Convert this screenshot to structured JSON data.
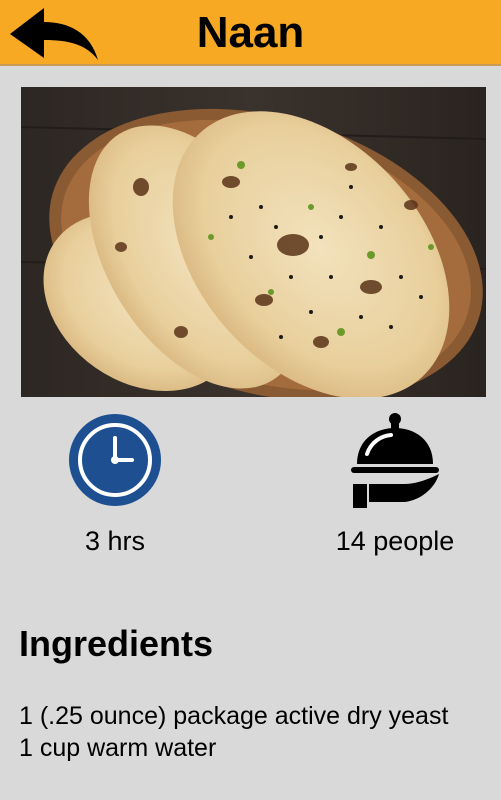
{
  "header": {
    "title": "Naan",
    "back_icon": "back-arrow-icon",
    "background_color": "#f7a924"
  },
  "hero_image": {
    "subject": "naan bread in basket"
  },
  "stats": {
    "time": {
      "icon": "clock-icon",
      "label": "3 hrs",
      "icon_color": "#1d4f91"
    },
    "serves": {
      "icon": "serving-cloche-icon",
      "label": "14 people"
    }
  },
  "ingredients": {
    "heading": "Ingredients",
    "items": [
      "1 (.25 ounce) package active dry yeast",
      "1 cup warm water"
    ]
  }
}
